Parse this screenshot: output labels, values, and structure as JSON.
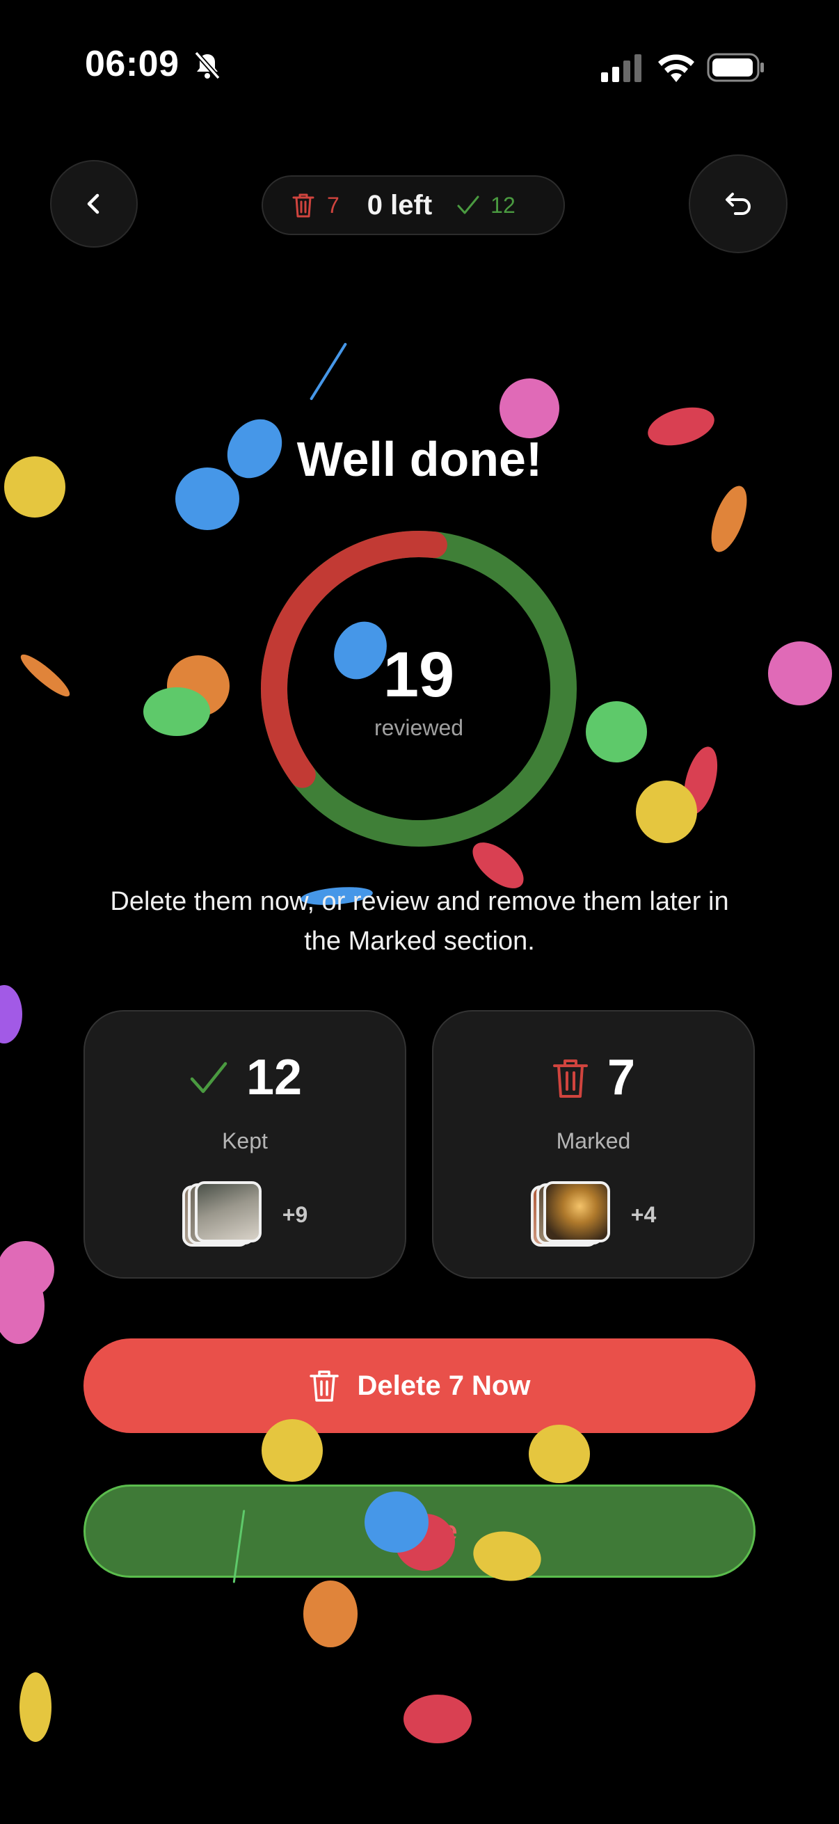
{
  "status_bar": {
    "time": "06:09"
  },
  "header": {
    "trash_count": "7",
    "left_label": "0 left",
    "kept_count": "12"
  },
  "summary": {
    "title": "Well done!",
    "reviewed_count": "19",
    "reviewed_label": "reviewed",
    "kept_fraction": 0.632,
    "marked_fraction": 0.368,
    "description": "Delete them now, or review and remove them later in the Marked section."
  },
  "cards": {
    "kept": {
      "count": "12",
      "label": "Kept",
      "more": "+9"
    },
    "marked": {
      "count": "7",
      "label": "Marked",
      "more": "+4"
    }
  },
  "actions": {
    "delete_label": "Delete 7 Now",
    "close_label": "Close"
  },
  "colors": {
    "red": "#e9504a",
    "green": "#3f7a37",
    "ring_red": "#c23a34",
    "ring_green": "#3f7f37"
  }
}
